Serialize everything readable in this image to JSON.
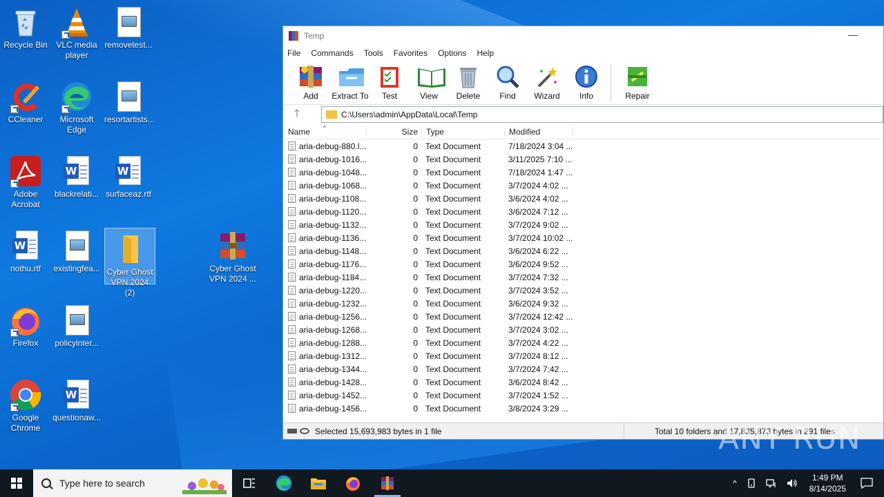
{
  "desktop": {
    "icons": [
      {
        "label": "Recycle Bin",
        "icon": "recycle-bin-icon"
      },
      {
        "label": "VLC media player",
        "icon": "vlc-icon"
      },
      {
        "label": "removetest...",
        "icon": "image-file-icon"
      },
      {
        "label": "CCleaner",
        "icon": "ccleaner-icon"
      },
      {
        "label": "Microsoft Edge",
        "icon": "edge-icon"
      },
      {
        "label": "resortartists...",
        "icon": "image-file-icon"
      },
      {
        "label": "Adobe Acrobat",
        "icon": "acrobat-icon"
      },
      {
        "label": "blackrelati...",
        "icon": "word-doc-icon"
      },
      {
        "label": "surfaceaz.rtf",
        "icon": "word-doc-icon"
      },
      {
        "label": "nothu.rtf",
        "icon": "word-doc-icon"
      },
      {
        "label": "existingfea...",
        "icon": "image-file-icon"
      },
      {
        "label": "Cyber Ghost VPN 2024 (2)",
        "icon": "folder-icon"
      },
      {
        "label": "Cyber Ghost VPN 2024 ...",
        "icon": "winrar-archive-icon"
      },
      {
        "label": "Firefox",
        "icon": "firefox-icon"
      },
      {
        "label": "policyinter...",
        "icon": "image-file-icon"
      },
      {
        "label": "Google Chrome",
        "icon": "chrome-icon"
      },
      {
        "label": "questionaw...",
        "icon": "word-doc-icon"
      }
    ]
  },
  "window": {
    "title": "Temp",
    "minimize": "—",
    "menu": [
      "File",
      "Commands",
      "Tools",
      "Favorites",
      "Options",
      "Help"
    ],
    "toolbar": [
      "Add",
      "Extract To",
      "Test",
      "View",
      "Delete",
      "Find",
      "Wizard",
      "Info",
      "Repair"
    ],
    "address": "C:\\Users\\admin\\AppData\\Local\\Temp",
    "up_arrow": "🡑",
    "columns": {
      "name": "Name",
      "size": "Size",
      "type": "Type",
      "modified": "Modified"
    },
    "sort_arrow": "^",
    "files": [
      {
        "name": "aria-debug-880.l...",
        "size": "0",
        "type": "Text Document",
        "modified": "7/18/2024 3:04 ..."
      },
      {
        "name": "aria-debug-1016...",
        "size": "0",
        "type": "Text Document",
        "modified": "3/11/2025 7:10 ..."
      },
      {
        "name": "aria-debug-1048...",
        "size": "0",
        "type": "Text Document",
        "modified": "7/18/2024 1:47 ..."
      },
      {
        "name": "aria-debug-1068...",
        "size": "0",
        "type": "Text Document",
        "modified": "3/7/2024 4:02 ..."
      },
      {
        "name": "aria-debug-1108...",
        "size": "0",
        "type": "Text Document",
        "modified": "3/6/2024 4:02 ..."
      },
      {
        "name": "aria-debug-1120...",
        "size": "0",
        "type": "Text Document",
        "modified": "3/6/2024 7:12 ..."
      },
      {
        "name": "aria-debug-1132...",
        "size": "0",
        "type": "Text Document",
        "modified": "3/7/2024 9:02 ..."
      },
      {
        "name": "aria-debug-1136...",
        "size": "0",
        "type": "Text Document",
        "modified": "3/7/2024 10:02 ..."
      },
      {
        "name": "aria-debug-1148...",
        "size": "0",
        "type": "Text Document",
        "modified": "3/6/2024 6:22 ..."
      },
      {
        "name": "aria-debug-1176...",
        "size": "0",
        "type": "Text Document",
        "modified": "3/6/2024 9:52 ..."
      },
      {
        "name": "aria-debug-1184...",
        "size": "0",
        "type": "Text Document",
        "modified": "3/7/2024 7:32 ..."
      },
      {
        "name": "aria-debug-1220...",
        "size": "0",
        "type": "Text Document",
        "modified": "3/7/2024 3:52 ..."
      },
      {
        "name": "aria-debug-1232...",
        "size": "0",
        "type": "Text Document",
        "modified": "3/6/2024 9:32 ..."
      },
      {
        "name": "aria-debug-1256...",
        "size": "0",
        "type": "Text Document",
        "modified": "3/7/2024 12:42 ..."
      },
      {
        "name": "aria-debug-1268...",
        "size": "0",
        "type": "Text Document",
        "modified": "3/7/2024 3:02 ..."
      },
      {
        "name": "aria-debug-1288...",
        "size": "0",
        "type": "Text Document",
        "modified": "3/7/2024 4:22 ..."
      },
      {
        "name": "aria-debug-1312...",
        "size": "0",
        "type": "Text Document",
        "modified": "3/7/2024 8:12 ..."
      },
      {
        "name": "aria-debug-1344...",
        "size": "0",
        "type": "Text Document",
        "modified": "3/7/2024 7:42 ..."
      },
      {
        "name": "aria-debug-1428...",
        "size": "0",
        "type": "Text Document",
        "modified": "3/6/2024 8:42 ..."
      },
      {
        "name": "aria-debug-1452...",
        "size": "0",
        "type": "Text Document",
        "modified": "3/7/2024 1:52 ..."
      },
      {
        "name": "aria-debug-1456...",
        "size": "0",
        "type": "Text Document",
        "modified": "3/8/2024 3:29 ..."
      }
    ],
    "status_left": "Selected 15,693,983 bytes in 1 file",
    "status_right": "Total 10 folders and 17,835,873 bytes in 291 files"
  },
  "watermark": "ANY RUN",
  "taskbar": {
    "search_placeholder": "Type here to search",
    "time": "1:49 PM",
    "date": "8/14/2025",
    "tray_chevron": "^"
  },
  "colors": {
    "accent": "#0f7ae0",
    "taskbar": "#101820",
    "active_indicator": "#7ab8f0"
  }
}
